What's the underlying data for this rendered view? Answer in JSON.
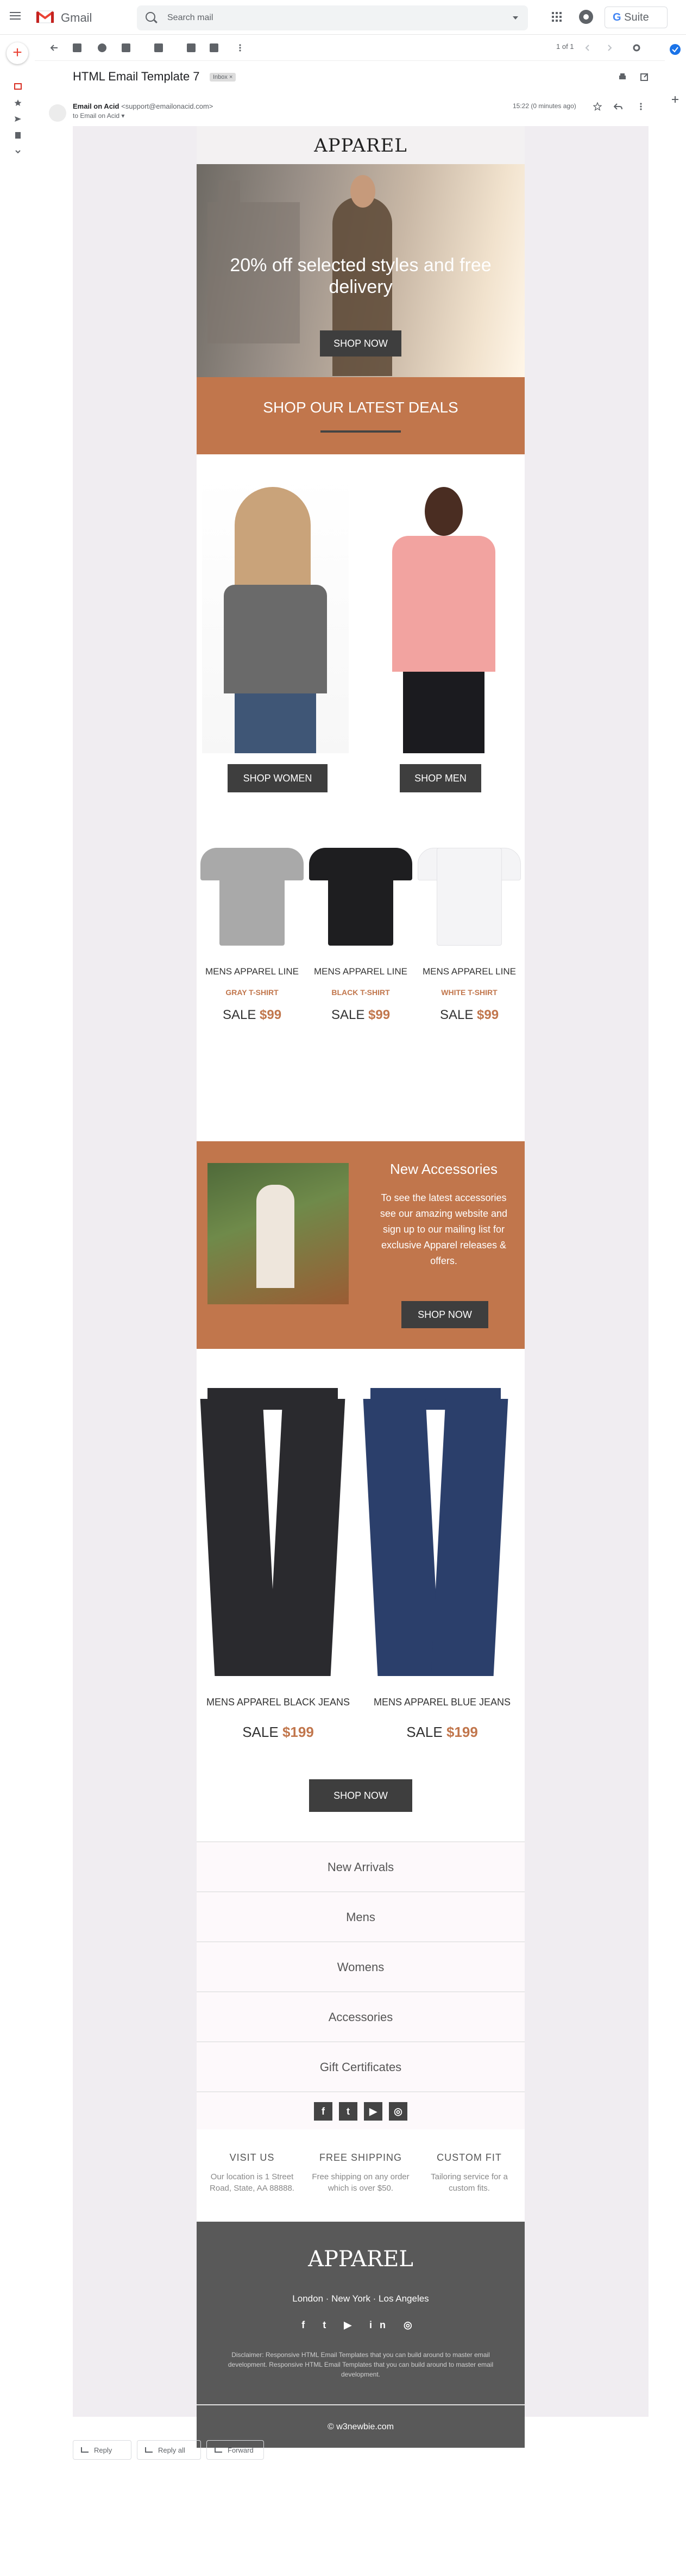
{
  "gmail": {
    "app_name": "Gmail",
    "search_placeholder": "Search mail",
    "gsuite_g": "G",
    "gsuite_rest": " Suite",
    "pager": "1 of 1",
    "subject": "HTML Email Template 7",
    "inbox_badge": "Inbox ×",
    "sender_name": "Email on Acid",
    "sender_addr": " <support@emailonacid.com>",
    "to_line": "to Email on Acid ▾",
    "time": "15:22 (0 minutes ago)",
    "reply": "Reply",
    "reply_all": "Reply all",
    "forward": "Forward"
  },
  "email": {
    "brand": "APPAREL",
    "hero_title": "20% off selected styles and free delivery",
    "hero_cta": "SHOP NOW",
    "deals_title": "SHOP OUR LATEST DEALS",
    "shop_women": "SHOP WOMEN",
    "shop_men": "SHOP MEN",
    "tees": [
      {
        "name": "MENS APPAREL LINE",
        "variant": "GRAY T-SHIRT",
        "sale": "SALE ",
        "price": "$99",
        "color": "#a9a9a9"
      },
      {
        "name": "MENS APPAREL LINE",
        "variant": "BLACK T-SHIRT",
        "sale": "SALE ",
        "price": "$99",
        "color": "#1e1e20"
      },
      {
        "name": "MENS APPAREL LINE",
        "variant": "WHITE T-SHIRT",
        "sale": "SALE ",
        "price": "$99",
        "color": "#f4f4f6"
      }
    ],
    "accessories": {
      "title": "New Accessories",
      "body": "To see the latest accessories see our amazing website and sign up to our mailing list for exclusive Apparel releases & offers.",
      "cta": "SHOP NOW"
    },
    "jeans": [
      {
        "label": "MENS APPAREL BLACK JEANS",
        "sale": "SALE ",
        "price": "$199",
        "color": "#2a2a2e"
      },
      {
        "label": "MENS APPAREL BLUE JEANS",
        "sale": "SALE ",
        "price": "$199",
        "color": "#2b3f6b"
      }
    ],
    "jeans_cta": "SHOP NOW",
    "nav": [
      "New Arrivals",
      "Mens",
      "Womens",
      "Accessories",
      "Gift Certificates"
    ],
    "social": [
      "f",
      "t",
      "▶",
      "◎"
    ],
    "features": [
      {
        "title": "VISIT US",
        "text": "Our location is 1 Street Road, State, AA 88888."
      },
      {
        "title": "FREE SHIPPING",
        "text": "Free shipping on any order which is over $50."
      },
      {
        "title": "CUSTOM FIT",
        "text": "Tailoring service for a custom fits."
      }
    ],
    "footer_brand": "APPAREL",
    "cities": "London · New York · Los Angeles",
    "footer_icons": "f t ▶ in ◎",
    "disclaimer": "Disclaimer: Responsive HTML Email Templates that you can build around to master email development. Responsive HTML Email Templates that you can build around to master email development.",
    "copyright": "© w3newbie.com"
  },
  "colors": {
    "accent": "#c1764c",
    "dark_button": "#3e3e3e",
    "footer": "#595959",
    "gmail_red": "#ea4335",
    "page_bg": "#f0edf1"
  }
}
